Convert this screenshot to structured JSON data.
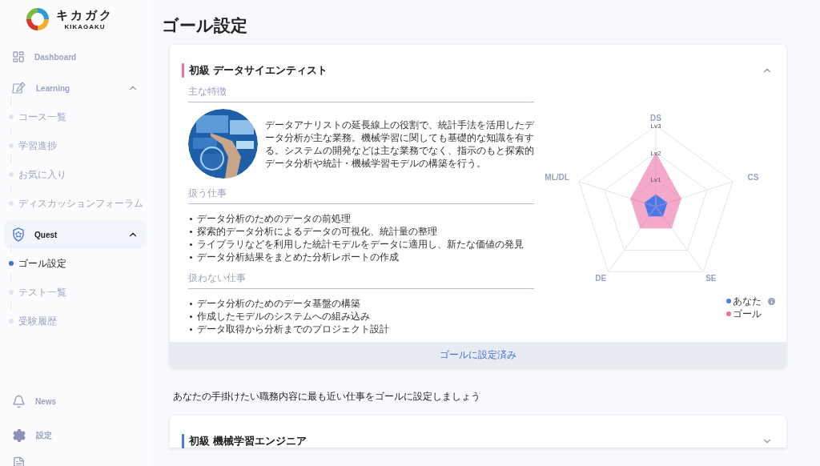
{
  "sidebar": {
    "logo": {
      "name": "キカガク",
      "subtitle": "KIKAGAKU"
    },
    "items": [
      {
        "label": "Dashboard",
        "selected": false
      },
      {
        "label": "Learning",
        "selected": false,
        "expanded": true,
        "children": [
          {
            "label": "コース一覧",
            "selected": false
          },
          {
            "label": "学習進捗",
            "selected": false
          },
          {
            "label": "お気に入り",
            "selected": false
          },
          {
            "label": "ディスカッションフォーラム",
            "selected": false
          }
        ]
      },
      {
        "label": "Quest",
        "selected": true,
        "expanded": true,
        "children": [
          {
            "label": "ゴール設定",
            "selected": true
          },
          {
            "label": "テスト一覧",
            "selected": false
          },
          {
            "label": "受験履歴",
            "selected": false
          }
        ]
      }
    ],
    "footer_items": [
      {
        "label": "News"
      },
      {
        "label": "設定"
      }
    ]
  },
  "page": {
    "title": "ゴール設定"
  },
  "cards": [
    {
      "title": "初級 データサイエンティスト",
      "color": "#f06fa5",
      "expanded": true,
      "features": {
        "heading": "主な特徴",
        "description": "データアナリストの延長線上の役割で、統計手法を活用したデータ分析が主な業務。機械学習に関しても基礎的な知識を有する。システムの開発などは主な業務でなく、指示のもと探索的データ分析や統計・機械学習モデルの構築を行う。"
      },
      "tasks": {
        "heading": "扱う仕事",
        "items": [
          "データ分析のためのデータの前処理",
          "探索的データ分析によるデータの可視化、統計量の整理",
          "ライブラリなどを利用した統計モデルをデータに適用し、新たな価値の発見",
          "データ分析結果をまとめた分析レポートの作成"
        ]
      },
      "non_tasks": {
        "heading": "扱わない仕事",
        "items": [
          "データ分析のためのデータ基盤の構築",
          "作成したモデルのシステムへの組み込み",
          "データ取得から分析までのプロジェクト設計"
        ]
      },
      "radar": {
        "axes": [
          "DS",
          "CS",
          "SE",
          "DE",
          "ML/DL"
        ],
        "ticks": [
          "Lv3",
          "Lv2",
          "Lv1"
        ],
        "series": [
          {
            "name": "あなた",
            "color": "#4a78e6",
            "info": true,
            "points": [
              {
                "level": 0.15
              },
              {
                "level": 0.15
              },
              {
                "level": 0.15
              },
              {
                "level": 0.15
              },
              {
                "level": 0.15
              }
            ]
          },
          {
            "name": "ゴール",
            "color": "#ee6fa6",
            "info": false,
            "points": [
              {
                "level": 0.67
              },
              {
                "level": 0.33
              },
              {
                "level": 0.33
              },
              {
                "level": 0.33
              },
              {
                "level": 0.33
              }
            ]
          }
        ]
      },
      "footer": "ゴールに設定済み"
    }
  ],
  "prompt": "あなたの手掛けたい職務内容に最も近い仕事をゴールに設定しましょう",
  "next_card": {
    "title": "初級 機械学習エンジニア",
    "color": "#4a78e6",
    "expanded": false
  }
}
